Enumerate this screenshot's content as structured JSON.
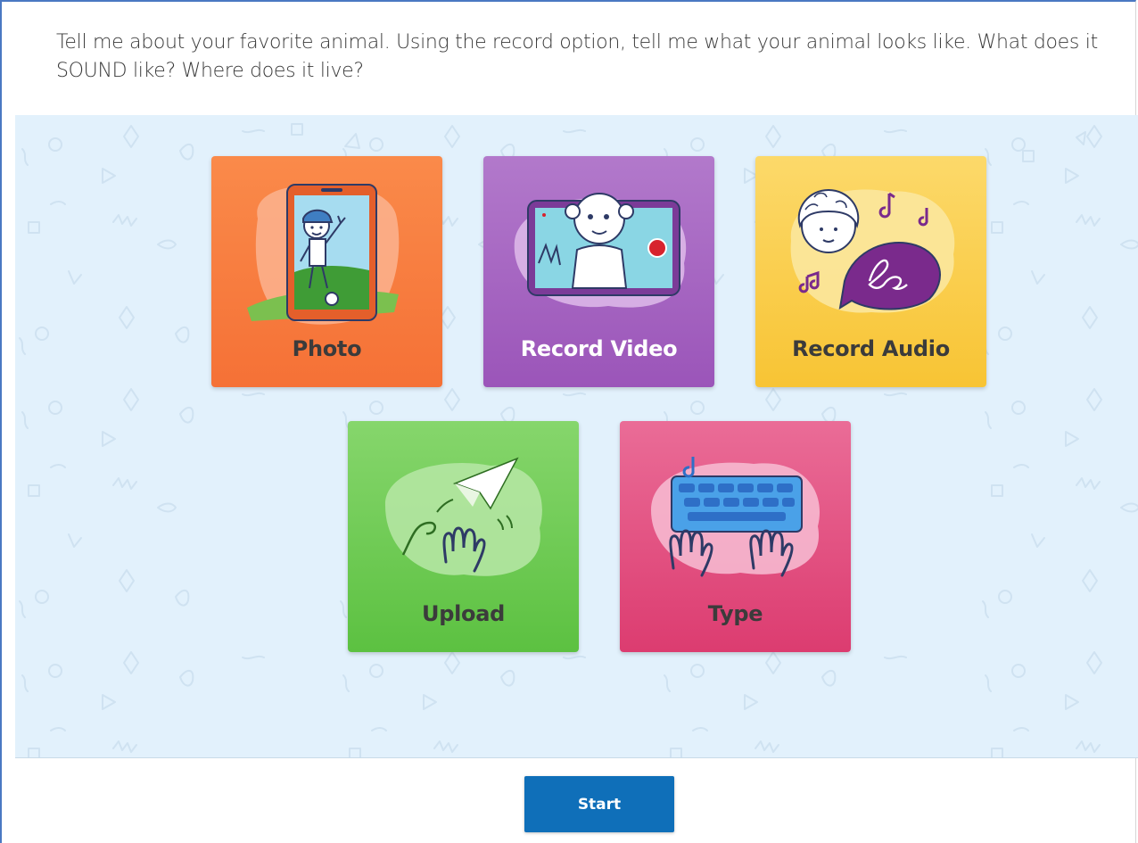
{
  "prompt": {
    "text": "Tell me about your favorite animal.  Using the record option, tell me what your animal looks like.  What does it SOUND like?  Where does it live?"
  },
  "options": [
    {
      "label": "Photo",
      "icon": "phone-camera-icon",
      "color": "#f57c3e"
    },
    {
      "label": "Record Video",
      "icon": "video-tablet-icon",
      "color": "#a865c2"
    },
    {
      "label": "Record Audio",
      "icon": "audio-speech-icon",
      "color": "#f9cf4e"
    },
    {
      "label": "Upload",
      "icon": "paper-plane-icon",
      "color": "#70cb55"
    },
    {
      "label": "Type",
      "icon": "keyboard-icon",
      "color": "#e2527f"
    }
  ],
  "start_button": {
    "label": "Start",
    "color": "#0f6fb9"
  }
}
